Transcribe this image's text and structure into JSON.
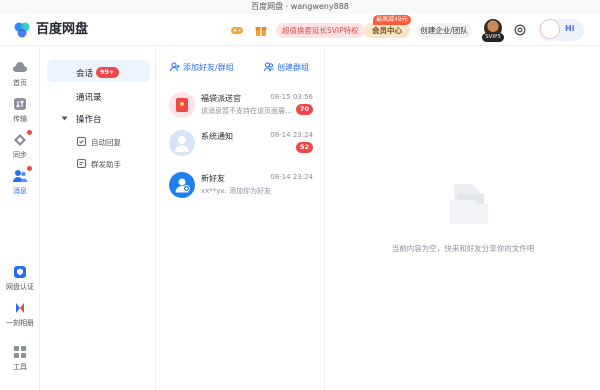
{
  "window": {
    "title": "百度网盘 · wangweny888"
  },
  "header": {
    "logo_text": "百度网盘",
    "promo_text": "超值换套延长SVIP特权",
    "member_tag": "最高减49元",
    "member_label": "会员中心",
    "enterprise_label": "创建企业/团队",
    "svip_level": "SVIP5",
    "greeting": "Hi"
  },
  "rail": {
    "items": [
      {
        "label": "首页",
        "icon": "cloud-icon"
      },
      {
        "label": "传输",
        "icon": "transfer-icon"
      },
      {
        "label": "同步",
        "icon": "sync-icon"
      },
      {
        "label": "消息",
        "icon": "message-icon"
      },
      {
        "label": "网盘认证",
        "icon": "certify-icon"
      },
      {
        "label": "一刻相册",
        "icon": "album-icon"
      },
      {
        "label": "工具",
        "icon": "tools-icon"
      }
    ]
  },
  "nav": {
    "conversation": "会话",
    "conversation_badge": "99+",
    "contacts": "通讯录",
    "workbench": "操作台",
    "auto_reply": "自动回复",
    "group_assistant": "群发助手"
  },
  "conv_actions": {
    "add_friend": "添加好友/群组",
    "create_group": "创建群组"
  },
  "conversations": [
    {
      "name": "福袋派送官",
      "time": "08-15 03:56",
      "preview": "该消息暂不支持在该页面展示...",
      "count": "70"
    },
    {
      "name": "系统通知",
      "time": "08-14 23:24",
      "preview": "",
      "count": "52"
    },
    {
      "name": "新好友",
      "time": "08-14 23:24",
      "preview": "xx**yx: 添加你为好友",
      "count": ""
    }
  ],
  "empty_state": {
    "text": "当前内容为空，快来和好友分享你的文件吧"
  },
  "colors": {
    "accent": "#2b6cf5",
    "badge": "#f04848",
    "active_bg": "#eef4ff"
  }
}
